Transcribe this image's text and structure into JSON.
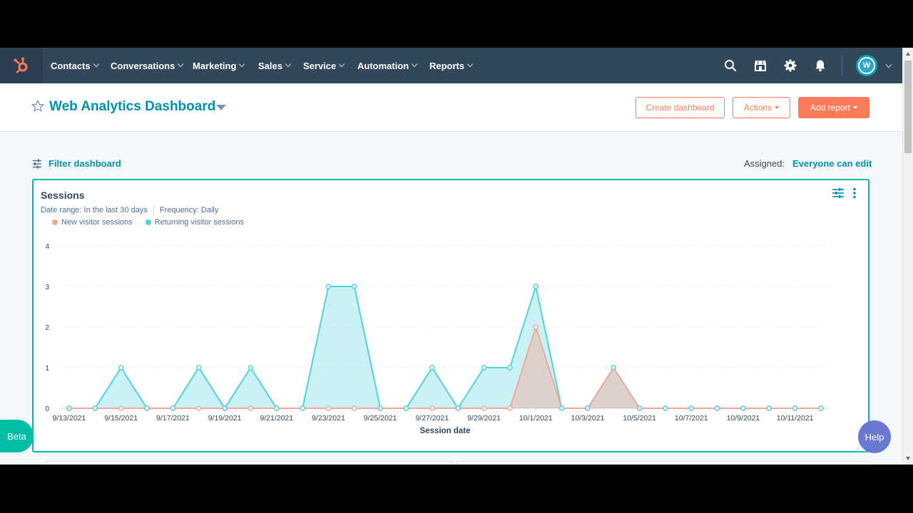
{
  "nav": {
    "items": [
      {
        "label": "Contacts"
      },
      {
        "label": "Conversations"
      },
      {
        "label": "Marketing"
      },
      {
        "label": "Sales"
      },
      {
        "label": "Service"
      },
      {
        "label": "Automation"
      },
      {
        "label": "Reports"
      }
    ],
    "icons": [
      "search-icon",
      "marketplace-icon",
      "settings-gear-icon",
      "notifications-bell-icon"
    ],
    "avatar_initial": "W",
    "colors": {
      "bar": "#33475b",
      "logo": "#ff7a59"
    }
  },
  "header": {
    "title": "Web Analytics Dashboard",
    "create_label": "Create dashboard",
    "actions_label": "Actions",
    "add_report_label": "Add report"
  },
  "filter": {
    "label": "Filter dashboard",
    "assigned_label": "Assigned:",
    "assigned_value": "Everyone can edit"
  },
  "card": {
    "title": "Sessions",
    "date_range": "Date range:  In the last 30 days",
    "frequency": "Frequency:  Daily"
  },
  "chart_data": {
    "type": "area",
    "xlabel": "Session date",
    "ylabel": "",
    "ylim": [
      0,
      4
    ],
    "yticks": [
      "0",
      "1",
      "2",
      "3",
      "4"
    ],
    "x": [
      "9/13/2021",
      "9/14/2021",
      "9/15/2021",
      "9/16/2021",
      "9/17/2021",
      "9/18/2021",
      "9/19/2021",
      "9/20/2021",
      "9/21/2021",
      "9/22/2021",
      "9/23/2021",
      "9/24/2021",
      "9/25/2021",
      "9/26/2021",
      "9/27/2021",
      "9/28/2021",
      "9/29/2021",
      "9/30/2021",
      "10/1/2021",
      "10/2/2021",
      "10/3/2021",
      "10/4/2021",
      "10/5/2021",
      "10/6/2021",
      "10/7/2021",
      "10/8/2021",
      "10/9/2021",
      "10/10/2021",
      "10/11/2021",
      "10/12/2021"
    ],
    "xticks": [
      "9/13/2021",
      "9/15/2021",
      "9/17/2021",
      "9/19/2021",
      "9/21/2021",
      "9/23/2021",
      "9/25/2021",
      "9/27/2021",
      "9/29/2021",
      "10/1/2021",
      "10/3/2021",
      "10/5/2021",
      "10/7/2021",
      "10/9/2021",
      "10/11/2021"
    ],
    "series": [
      {
        "name": "New visitor sessions",
        "color": "#f2a899",
        "values": [
          0,
          0,
          0,
          0,
          0,
          0,
          0,
          0,
          0,
          0,
          0,
          0,
          0,
          0,
          0,
          0,
          0,
          0,
          2,
          0,
          0,
          1,
          0,
          0,
          0,
          0,
          0,
          0,
          0,
          0
        ]
      },
      {
        "name": "Returning visitor sessions",
        "color": "#51d3d9",
        "values": [
          0,
          0,
          1,
          0,
          0,
          1,
          0,
          1,
          0,
          0,
          3,
          3,
          0,
          0,
          1,
          0,
          1,
          1,
          3,
          0,
          0,
          1,
          0,
          0,
          0,
          0,
          0,
          0,
          0,
          0
        ]
      }
    ],
    "grid": true,
    "legend": "top-left"
  },
  "beta_label": "Beta",
  "help_label": "Help"
}
